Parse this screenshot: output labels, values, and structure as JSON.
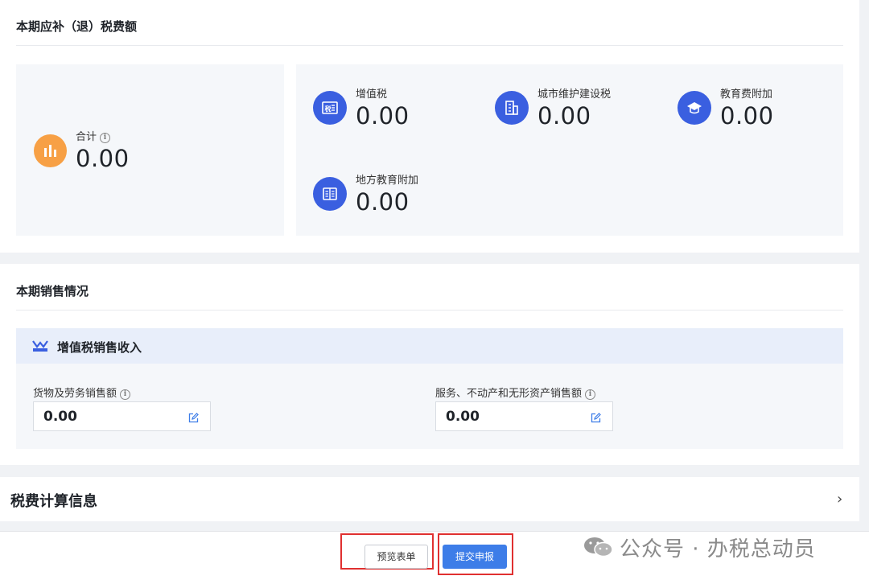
{
  "section1": {
    "title": "本期应补（退）税费额",
    "total": {
      "label": "合计",
      "value": "0.00"
    },
    "items": [
      {
        "label": "增值税",
        "value": "0.00",
        "icon": "tax-doc-icon"
      },
      {
        "label": "城市维护建设税",
        "value": "0.00",
        "icon": "building-icon"
      },
      {
        "label": "教育费附加",
        "value": "0.00",
        "icon": "graduation-cap-icon"
      },
      {
        "label": "地方教育附加",
        "value": "0.00",
        "icon": "book-icon"
      }
    ]
  },
  "section2": {
    "title": "本期销售情况",
    "vat_title": "增值税销售收入",
    "fields": [
      {
        "label": "货物及劳务销售额",
        "value": "0.00"
      },
      {
        "label": "服务、不动产和无形资产销售额",
        "value": "0.00"
      }
    ]
  },
  "section3": {
    "title": "税费计算信息",
    "chevron": "›"
  },
  "actions": {
    "preview_label": "预览表单",
    "submit_label": "提交申报"
  },
  "watermark": {
    "text": "公众号 · 办税总动员"
  },
  "colors": {
    "accent": "#3d7de8",
    "icon_blue": "#3a5fe0",
    "icon_orange": "#f7a045",
    "highlight": "#e03030"
  }
}
